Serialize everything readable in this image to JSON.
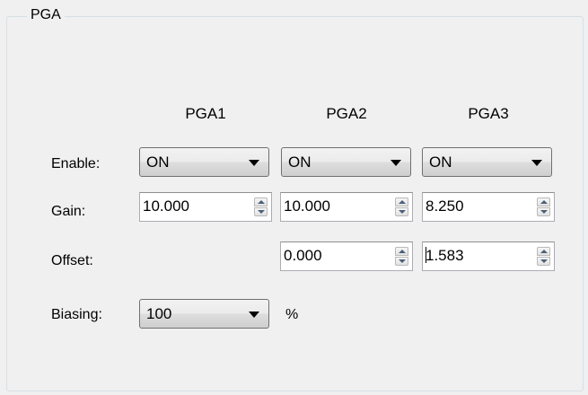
{
  "group": {
    "title": "PGA"
  },
  "columns": [
    "PGA1",
    "PGA2",
    "PGA3"
  ],
  "rows": {
    "enable": {
      "label": "Enable:",
      "values": [
        "ON",
        "ON",
        "ON"
      ]
    },
    "gain": {
      "label": "Gain:",
      "values": [
        "10.000",
        "10.000",
        "8.250"
      ]
    },
    "offset": {
      "label": "Offset:",
      "values": [
        "0.000",
        "1.583"
      ]
    },
    "biasing": {
      "label": "Biasing:",
      "value": "100",
      "unit": "%"
    }
  }
}
